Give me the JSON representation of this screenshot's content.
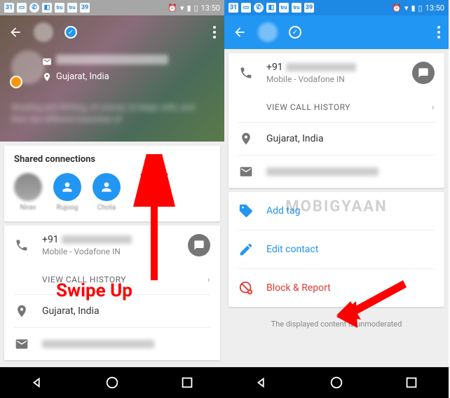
{
  "statusbar": {
    "time": "13:50",
    "badge_num": "39",
    "cal_num": "31"
  },
  "left": {
    "location": "Gujarat, India",
    "shared_title": "Shared connections",
    "phone_prefix": "+91",
    "phone_sub": "Mobile - Vodafone IN",
    "view_history": "VIEW CALL HISTORY",
    "loc2": "Gujarat, India"
  },
  "right": {
    "phone_prefix": "+91",
    "phone_sub": "Mobile - Vodafone IN",
    "view_history": "VIEW CALL HISTORY",
    "location": "Gujarat, India",
    "add_tag": "Add tag",
    "edit_contact": "Edit contact",
    "block_report": "Block & Report",
    "footer": "The displayed content is unmoderated"
  },
  "annotation": {
    "swipe": "Swipe Up",
    "watermark": "MOBIGYAAN"
  }
}
